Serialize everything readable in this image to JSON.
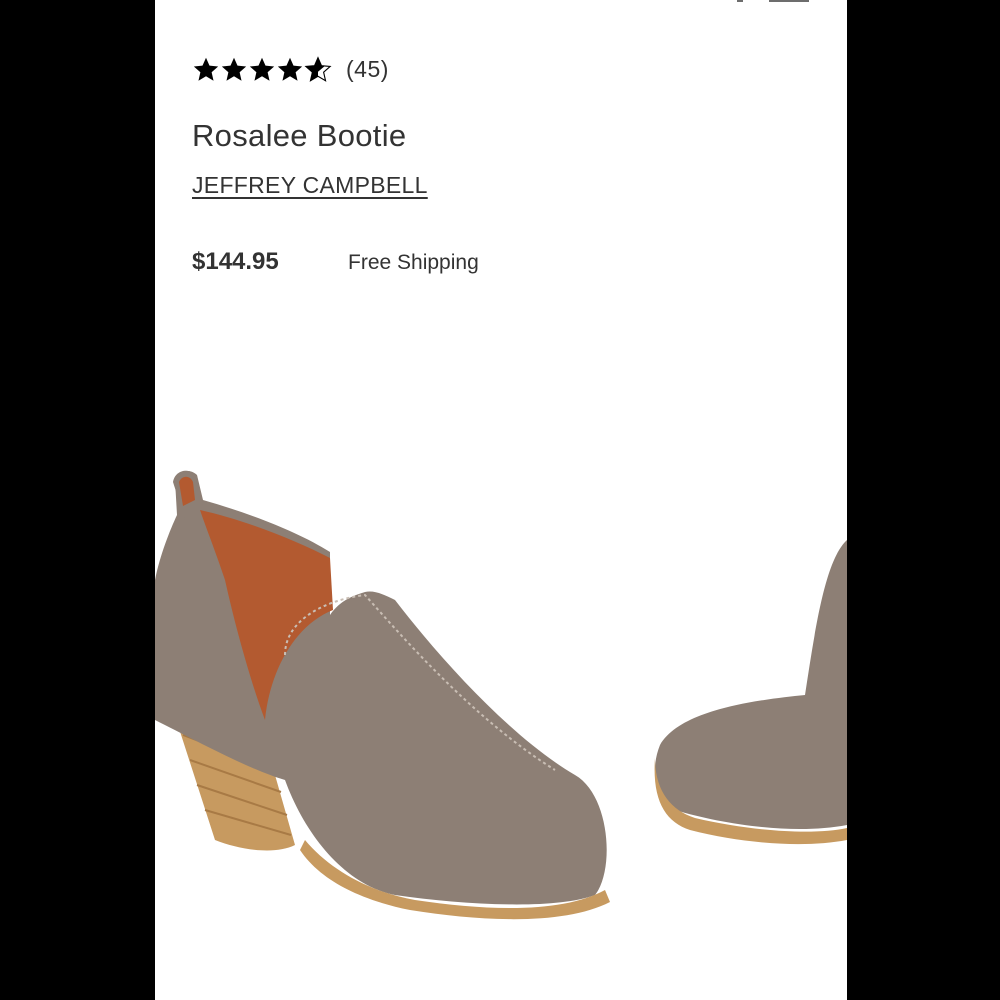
{
  "product": {
    "rating": {
      "stars": 4.5,
      "review_count": "(45)"
    },
    "title": "Rosalee Bootie",
    "brand": "JEFFREY CAMPBELL",
    "price": "$144.95",
    "shipping": "Free Shipping",
    "image_icon": "product-photo-bootie"
  },
  "colors": {
    "star": "#000000",
    "text": "#333333",
    "suede": "#8d7f75",
    "heel": "#c79a60",
    "lining": "#b35a30"
  }
}
